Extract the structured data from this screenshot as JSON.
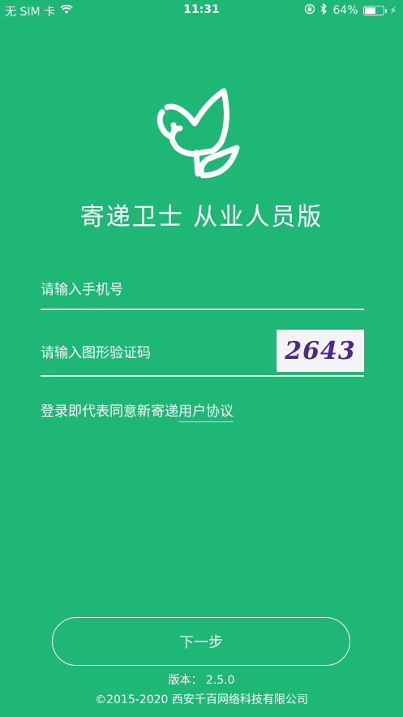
{
  "status_bar": {
    "carrier": "无 SIM 卡",
    "time": "11:31",
    "battery_percent": "64%",
    "battery_level": 0.64,
    "icons": [
      "wifi-icon",
      "orientation-lock-icon",
      "bluetooth-icon",
      "battery-icon",
      "charging-icon"
    ]
  },
  "app": {
    "title": "寄递卫士  从业人员版",
    "logo_icon": "bird-icon"
  },
  "form": {
    "phone_placeholder": "请输入手机号",
    "phone_value": "",
    "captcha_placeholder": "请输入图形验证码",
    "captcha_value": "",
    "captcha_image_text": "2643"
  },
  "agreement": {
    "prefix": "登录即代表同意新寄递",
    "link": "用户协议"
  },
  "next_button": "下一步",
  "footer": {
    "version": "版本：  2.5.0",
    "copyright": "©2015-2020 西安千百网络科技有限公司"
  },
  "colors": {
    "background": "#1fb776",
    "text": "#ffffff",
    "captcha_bg": "#f4f4f6",
    "captcha_text": "#4a2a8a"
  }
}
